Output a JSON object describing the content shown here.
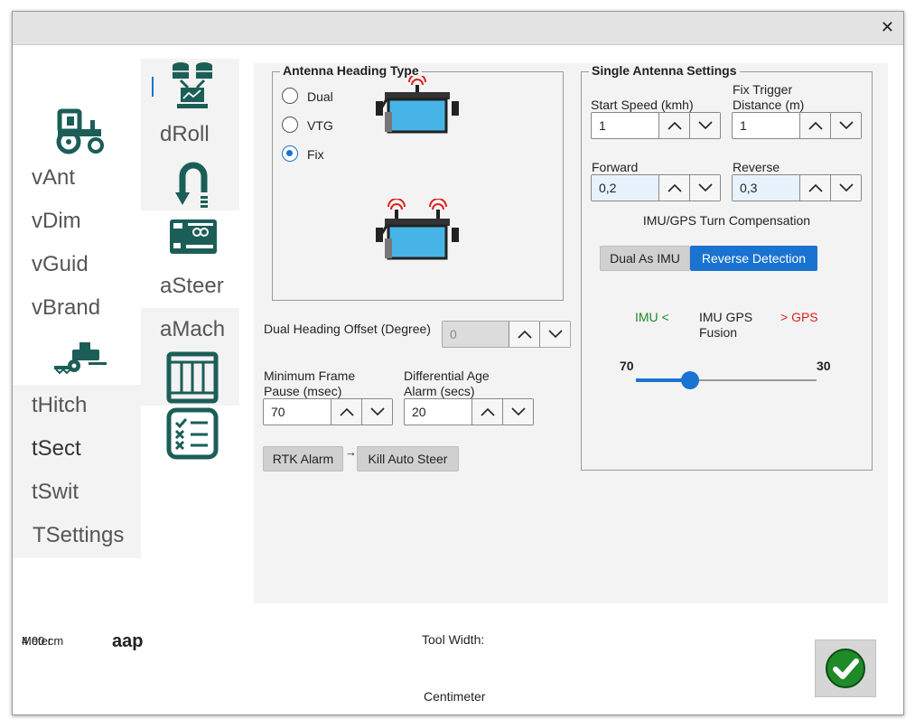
{
  "window": {
    "close_glyph": "✕"
  },
  "nav_left": {
    "items": [
      "vAnt",
      "vDim",
      "vGuid",
      "vBrand",
      "tHitch",
      "tSect",
      "tSwit",
      "TSettings"
    ]
  },
  "nav_mid": {
    "items": [
      "dRoll",
      "aSteer",
      "aMach"
    ]
  },
  "antenna_heading": {
    "title": "Antenna Heading Type",
    "options": [
      "Dual",
      "VTG",
      "Fix"
    ],
    "selected": "Fix"
  },
  "dual_offset": {
    "label": "Dual Heading Offset (Degree)",
    "value": "0"
  },
  "min_frame": {
    "label_line1": "Minimum Frame",
    "label_line2": "Pause (msec)",
    "value": "70"
  },
  "diff_age": {
    "label_line1": "Differential Age",
    "label_line2": "Alarm (secs)",
    "value": "20"
  },
  "rtk": {
    "alarm_label": "RTK Alarm",
    "arrow": "→",
    "kill_label": "Kill Auto Steer"
  },
  "single_antenna": {
    "title": "Single Antenna Settings",
    "start_speed": {
      "label": "Start Speed (kmh)",
      "value": "1"
    },
    "fix_trigger": {
      "label_line1": "Fix Trigger",
      "label_line2": "Distance (m)",
      "value": "1"
    },
    "forward": {
      "label": "Forward",
      "value": "0,2"
    },
    "reverse": {
      "label": "Reverse",
      "value": "0,3"
    },
    "imu_comp_label": "IMU/GPS Turn Compensation",
    "dual_as_imu": "Dual As IMU",
    "reverse_detection": "Reverse Detection",
    "imu_left": "IMU <",
    "fusion_line1": "IMU GPS",
    "fusion_line2": "Fusion",
    "gps_right": "> GPS",
    "slider_left_value": "70",
    "slider_right_value": "30",
    "slider_fraction": 0.3
  },
  "footer": {
    "overlap_a": "Meter",
    "overlap_b": "4.00 cm",
    "aap": "aap",
    "tool_width": "Tool Width:",
    "centimeter": "Centimeter"
  },
  "colors": {
    "teal": "#1b5e57",
    "blue": "#1a73d1",
    "green": "#1e8a28",
    "red": "#e02020"
  },
  "icons": [
    "tractor-icon",
    "seeder-icon",
    "database-icon",
    "u-turn-icon",
    "arduino-board-icon",
    "grid-box-icon",
    "checklist-icon",
    "green-check-icon"
  ]
}
